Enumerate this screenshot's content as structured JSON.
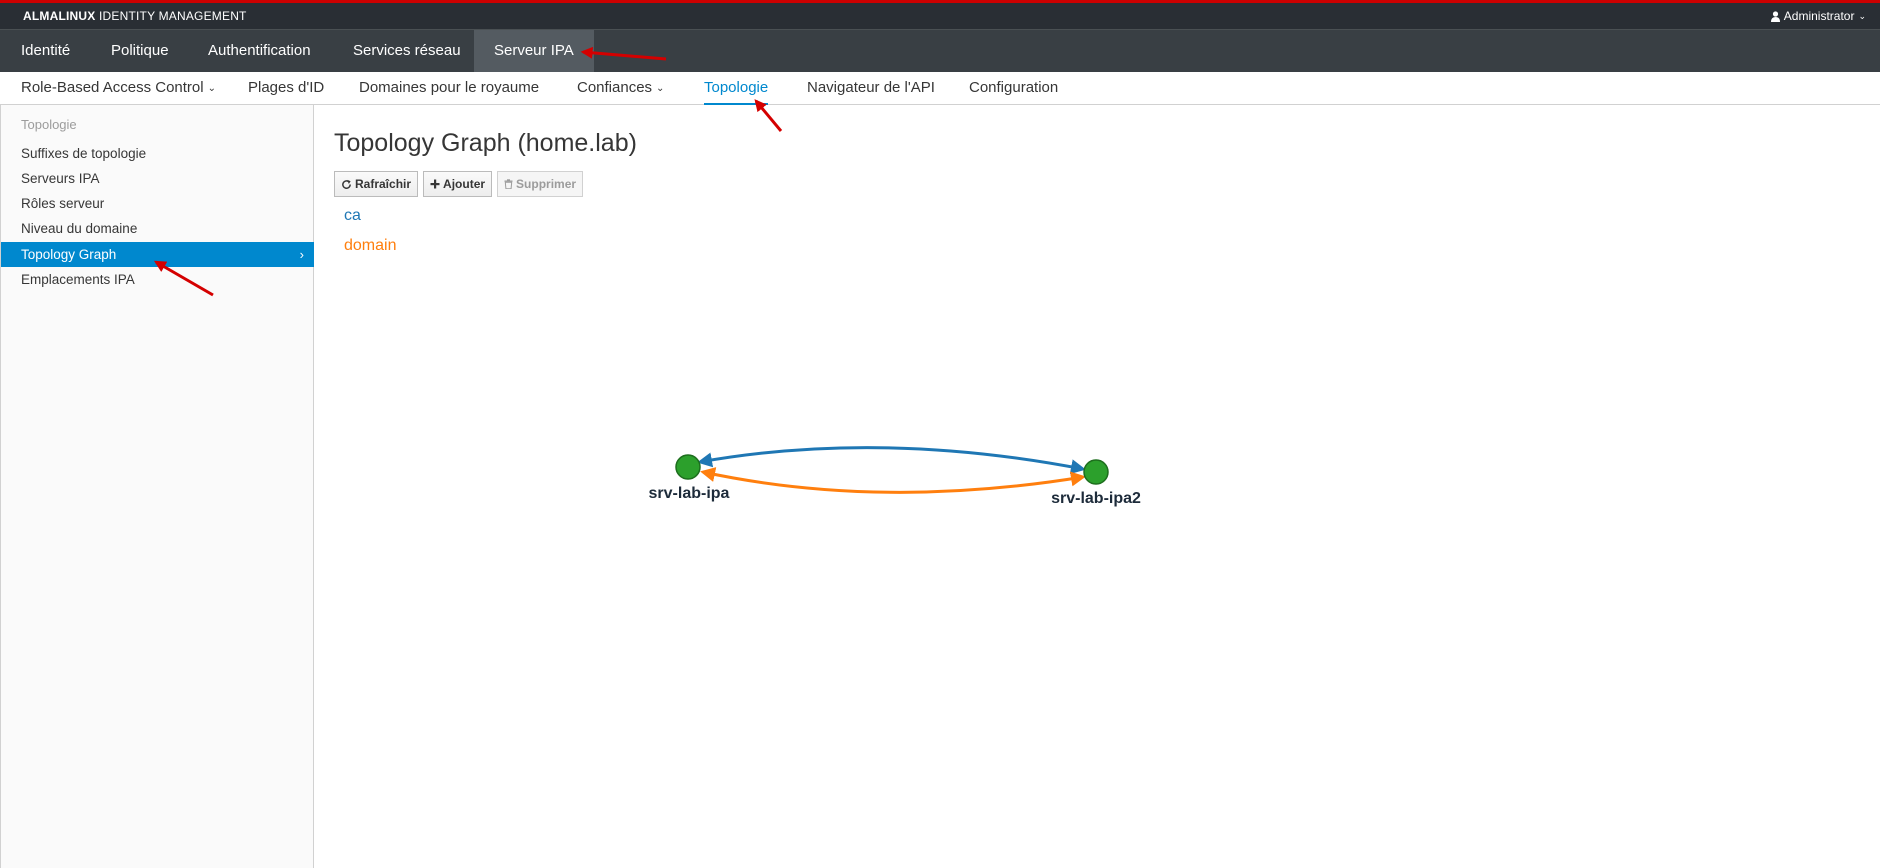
{
  "masthead": {
    "brand_bold": "ALMALINUX",
    "brand_rest": " IDENTITY MANAGEMENT",
    "user_label": "Administrator",
    "user_icon": "user-icon"
  },
  "primary_nav": [
    {
      "label": "Identité"
    },
    {
      "label": "Politique"
    },
    {
      "label": "Authentification"
    },
    {
      "label": "Services réseau"
    },
    {
      "label": "Serveur IPA",
      "active": true
    }
  ],
  "secondary_nav": [
    {
      "label": "Role-Based Access Control",
      "has_dropdown": true
    },
    {
      "label": "Plages d'ID"
    },
    {
      "label": "Domaines pour le royaume"
    },
    {
      "label": "Confiances",
      "has_dropdown": true
    },
    {
      "label": "Topologie",
      "active": true
    },
    {
      "label": "Navigateur de l'API"
    },
    {
      "label": "Configuration"
    }
  ],
  "sidebar": {
    "heading": "Topologie",
    "items": [
      {
        "label": "Suffixes de topologie"
      },
      {
        "label": "Serveurs IPA"
      },
      {
        "label": "Rôles serveur"
      },
      {
        "label": "Niveau du domaine"
      },
      {
        "label": "Topology Graph",
        "active": true
      },
      {
        "label": "Emplacements IPA"
      }
    ]
  },
  "main": {
    "title": "Topology Graph (home.lab)",
    "toolbar": {
      "refresh_label": "Rafraîchir",
      "add_label": "Ajouter",
      "delete_label": "Supprimer"
    },
    "legend": {
      "ca_label": "ca",
      "domain_label": "domain"
    }
  },
  "graph": {
    "nodes": [
      {
        "id": "srv-lab-ipa",
        "label": "srv-lab-ipa"
      },
      {
        "id": "srv-lab-ipa2",
        "label": "srv-lab-ipa2"
      }
    ],
    "edges": [
      {
        "suffix": "ca",
        "source": "srv-lab-ipa",
        "target": "srv-lab-ipa2"
      },
      {
        "suffix": "domain",
        "source": "srv-lab-ipa",
        "target": "srv-lab-ipa2"
      }
    ]
  },
  "colors": {
    "accent": "#0088ce",
    "ca": "#1f77b4",
    "domain": "#ff7f0e",
    "node_fill": "#2ca02c",
    "annotation_arrow": "#d40000",
    "masthead_bg": "#292e34",
    "primary_nav_bg": "#393f44"
  }
}
